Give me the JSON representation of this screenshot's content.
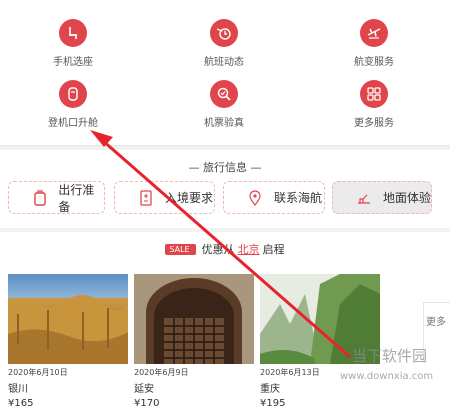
{
  "services": [
    {
      "label": "手机选座",
      "icon": "seat-icon"
    },
    {
      "label": "航班动态",
      "icon": "flight-status-icon"
    },
    {
      "label": "航变服务",
      "icon": "flight-change-icon"
    },
    {
      "label": "登机口升舱",
      "icon": "upgrade-icon"
    },
    {
      "label": "机票验真",
      "icon": "ticket-verify-icon"
    },
    {
      "label": "更多服务",
      "icon": "more-grid-icon"
    }
  ],
  "travel_info": {
    "title": "— 旅行信息 —",
    "buttons": [
      {
        "label": "出行准备",
        "icon": "luggage-icon"
      },
      {
        "label": "入境要求",
        "icon": "document-icon"
      },
      {
        "label": "联系海航",
        "icon": "location-pin-icon"
      },
      {
        "label": "地面体验",
        "icon": "ground-icon"
      }
    ]
  },
  "promo": {
    "sale_badge": "SALE",
    "prefix": "优惠从",
    "city": "北京",
    "suffix": "启程",
    "cards": [
      {
        "date": "2020年6月10日",
        "city": "银川",
        "price": "¥165"
      },
      {
        "date": "2020年6月9日",
        "city": "延安",
        "price": "¥170"
      },
      {
        "date": "2020年6月13日",
        "city": "重庆",
        "price": "¥195"
      }
    ],
    "more": "更多"
  },
  "watermark": {
    "brand": "当下软件园",
    "url": "www.downxia.com"
  },
  "colors": {
    "accent": "#e0454b",
    "arrow": "#e8232e"
  }
}
